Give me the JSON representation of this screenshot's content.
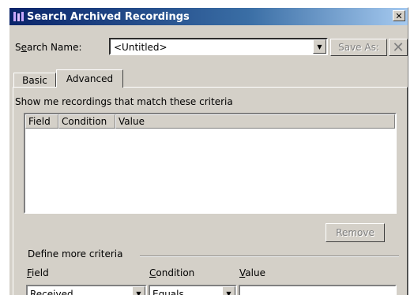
{
  "window": {
    "title": "Search Archived Recordings",
    "close_label": "✕"
  },
  "search": {
    "label_prefix": "S",
    "label_u": "e",
    "label_rest": "arch Name:",
    "value": "<Untitled>",
    "save_as": "Save As:"
  },
  "tabs": [
    {
      "label": "Basic"
    },
    {
      "label": "Advanced"
    }
  ],
  "panel": {
    "criteria_label": "Show me recordings that match these criteria",
    "columns": [
      "Field",
      "Condition",
      "Value"
    ],
    "remove_label": "Remove",
    "define_label": "Define more criteria",
    "field_label_u": "F",
    "field_label_rest": "ield",
    "condition_label_u": "C",
    "condition_label_rest": "ondition",
    "value_label_u": "V",
    "value_label_rest": "alue",
    "field_value": "Received",
    "condition_value": "Equals",
    "value_value": ""
  }
}
